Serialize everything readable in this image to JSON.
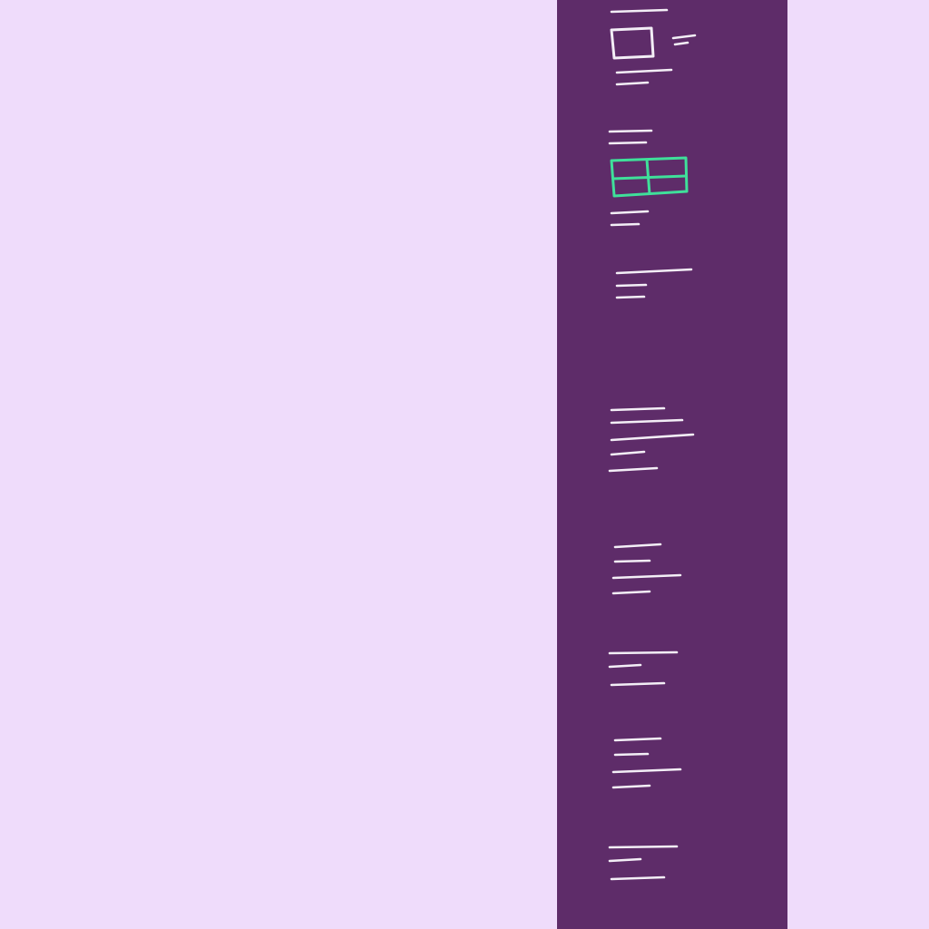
{
  "colors": {
    "background": "#efdcfb",
    "panel": "#5e2c69",
    "text_strokes": "#f3eef6",
    "selected_accent": "#3fe09a"
  },
  "panel": {
    "items": [
      {
        "icon": "single-frame-icon",
        "selected": false
      },
      {
        "icon": "grid-layout-icon",
        "selected": true
      },
      {
        "icon": null,
        "selected": false
      },
      {
        "icon": null,
        "selected": false
      },
      {
        "icon": null,
        "selected": false
      },
      {
        "icon": null,
        "selected": false
      },
      {
        "icon": null,
        "selected": false
      },
      {
        "icon": null,
        "selected": false
      }
    ]
  }
}
